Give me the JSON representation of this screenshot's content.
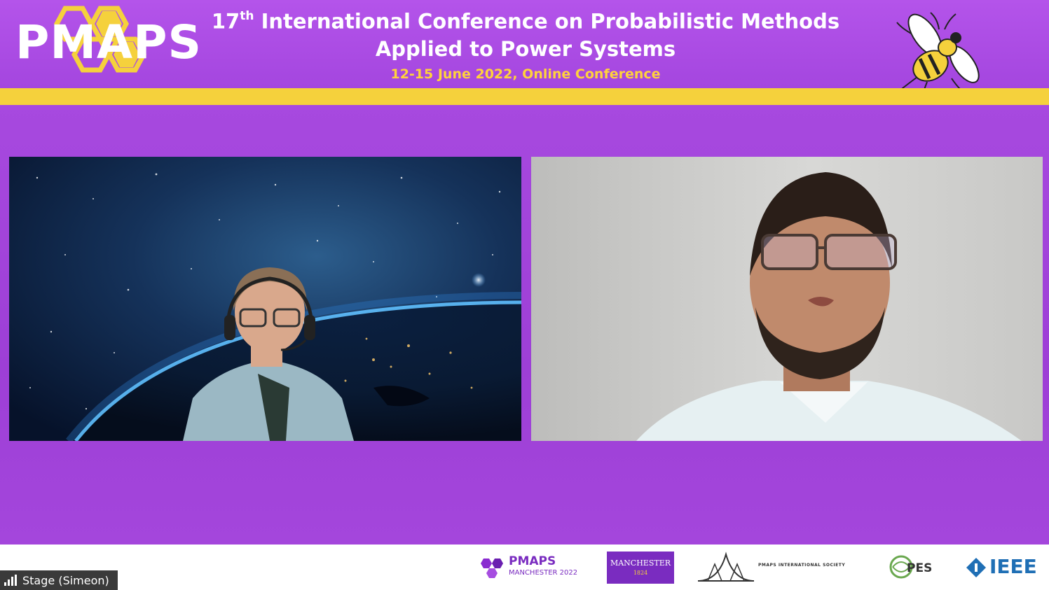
{
  "header": {
    "logo_text": "PMAPS",
    "title_prefix": "17",
    "title_superscript": "th",
    "title_line1_rest": " International Conference on Probabilistic Methods",
    "title_line2": "Applied to Power Systems",
    "date_line": "12-15 June 2022, Online Conference"
  },
  "colors": {
    "brand_purple": "#a446df",
    "accent_gold": "#f5d13c",
    "date_text": "#ffd23c"
  },
  "video_tiles": [
    {
      "id": "participant-1",
      "background": "earth-from-space"
    },
    {
      "id": "participant-2",
      "background": "plain-wall"
    }
  ],
  "footer": {
    "sponsors": [
      {
        "name": "PMAPS",
        "sub": "MANCHESTER 2022"
      },
      {
        "name": "MANCHESTER",
        "sub": "1824"
      },
      {
        "name": "PMAPS INTERNATIONAL SOCIETY"
      },
      {
        "name": "PES"
      },
      {
        "name": "IEEE"
      }
    ]
  },
  "stage_indicator": {
    "label": "Stage (Simeon)",
    "icon": "signal-bars-icon"
  }
}
